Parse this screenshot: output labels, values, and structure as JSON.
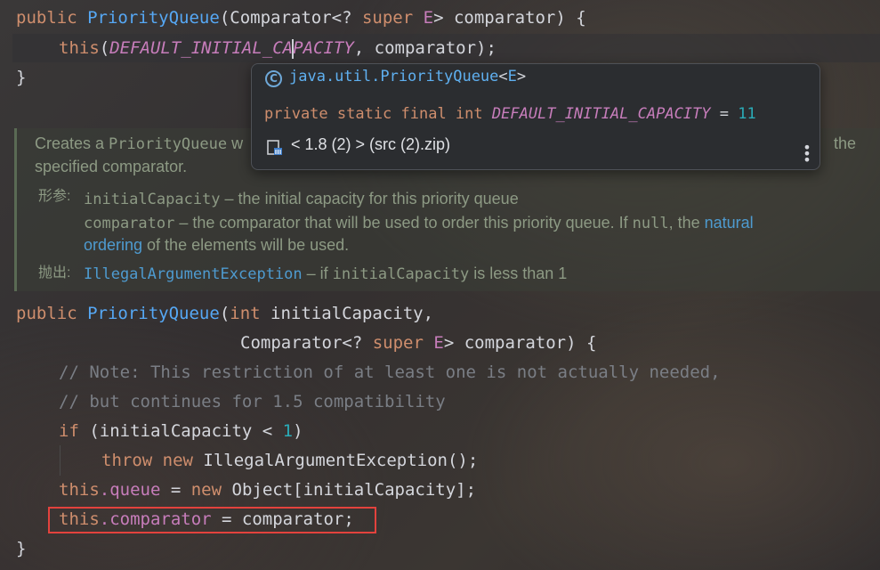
{
  "editor": {
    "lines": {
      "l1": {
        "public": "public",
        "name": "PriorityQueue",
        "open": "(Comparator<? ",
        "super": "super",
        "rest": " E",
        "close": "> comparator) {"
      },
      "l2": {
        "this": "this",
        "open": "(",
        "const_a": "DEFAULT_INITIAL_CA",
        "const_b": "PACITY",
        "rest": ", comparator);"
      },
      "l3": "}",
      "l4": {
        "public": "public",
        "name": "PriorityQueue",
        "open": "(",
        "int": "int",
        "rest": " initialCapacity,"
      },
      "l5": {
        "open": "Comparator<? ",
        "super": "super",
        "e": " E",
        "close": "> comparator) {"
      },
      "l6": "// Note: This restriction of at least one is not actually needed,",
      "l7": "// but continues for 1.5 compatibility",
      "l8": {
        "if": "if",
        "open": " (initialCapacity < ",
        "num": "1",
        "close": ")"
      },
      "l9": {
        "throw": "throw",
        "sp": " ",
        "new": "new",
        "rest": " IllegalArgumentException();"
      },
      "l10": {
        "this": "this",
        "field": ".queue",
        "eq": " = ",
        "new": "new",
        "rest": " Object[initialCapacity];"
      },
      "l11": {
        "this": "this",
        "field": ".comparator",
        "rest": " = comparator;"
      },
      "l12": "}"
    }
  },
  "doc": {
    "desc_a": "Creates a ",
    "desc_code": "PriorityQueue",
    "desc_b": " w",
    "desc_tail": "the",
    "desc_line2": "specified comparator.",
    "params_label": "形参:",
    "p1_name": "initialCapacity",
    "p1_desc": " – the initial capacity for this priority queue",
    "p2_name": "comparator",
    "p2_desc": " – the comparator that will be used to order this priority queue. If ",
    "p2_null": "null",
    "p2_desc2": ", the ",
    "p2_link1": "natural",
    "p2_link2": "ordering",
    "p2_desc3": " of the elements will be used.",
    "throws_label": "抛出:",
    "t1_name": "IllegalArgumentException",
    "t1_desc": " – if ",
    "t1_code": "initialCapacity",
    "t1_desc2": " is less than 1"
  },
  "popup": {
    "fqn": "java.util.PriorityQueue",
    "fqn_lt": "<",
    "fqn_e": "E",
    "fqn_gt": ">",
    "decl_mods": "private static final int ",
    "decl_name": "DEFAULT_INITIAL_CAPACITY",
    "decl_eq": " = ",
    "decl_val": "11",
    "source": "< 1.8 (2) > (src (2).zip)",
    "icons": {
      "class": "class-icon",
      "library": "library-icon",
      "more": "more-options-icon"
    }
  },
  "colors": {
    "highlight_border": "#e3423d",
    "keyword": "#cf8e6d",
    "function": "#56a8f5",
    "constant": "#c77dbb"
  }
}
